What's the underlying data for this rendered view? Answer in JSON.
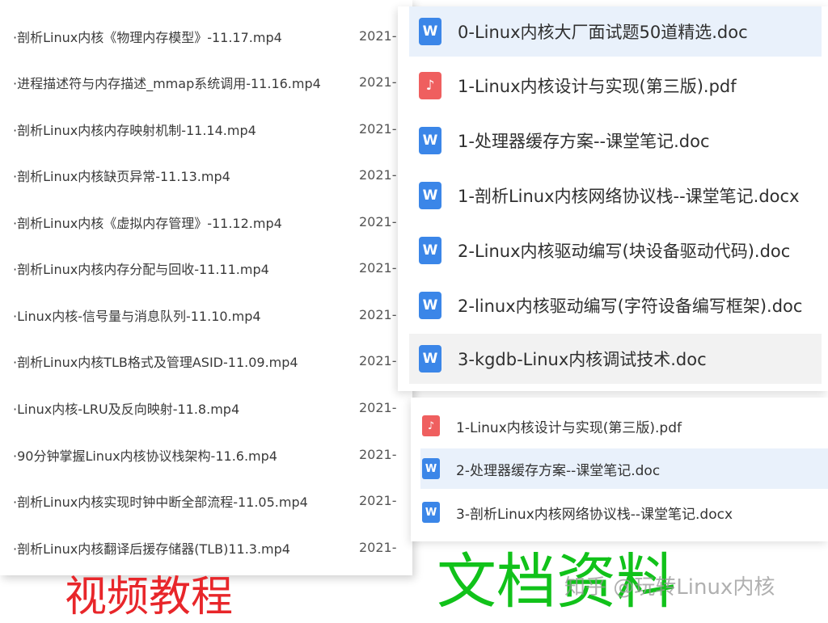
{
  "video_list": {
    "items": [
      {
        "name": "·剖析Linux内核《物理内存模型》-11.17.mp4",
        "date": "2021-"
      },
      {
        "name": "·进程描述符与内存描述_mmap系统调用-11.16.mp4",
        "date": "2021-"
      },
      {
        "name": "·剖析Linux内核内存映射机制-11.14.mp4",
        "date": "2021-"
      },
      {
        "name": "·剖析Linux内核缺页异常-11.13.mp4",
        "date": "2021-"
      },
      {
        "name": "·剖析Linux内核《虚拟内存管理》-11.12.mp4",
        "date": "2021-"
      },
      {
        "name": "·剖析Linux内核内存分配与回收-11.11.mp4",
        "date": "2021-"
      },
      {
        "name": "·Linux内核-信号量与消息队列-11.10.mp4",
        "date": "2021-"
      },
      {
        "name": "·剖析Linux内核TLB格式及管理ASID-11.09.mp4",
        "date": "2021-"
      },
      {
        "name": "·Linux内核-LRU及反向映射-11.8.mp4",
        "date": "2021-"
      },
      {
        "name": "·90分钟掌握Linux内核协议栈架构-11.6.mp4",
        "date": "2021-"
      },
      {
        "name": "·剖析Linux内核实现时钟中断全部流程-11.05.mp4",
        "date": "2021-"
      },
      {
        "name": "·剖析Linux内核翻译后援存储器(TLB)11.3.mp4",
        "date": "2021-"
      }
    ]
  },
  "doc_list_top": {
    "items": [
      {
        "icon": "word-doc-icon",
        "icon_glyph": "W",
        "name": "0-Linux内核大厂面试题50道精选.doc"
      },
      {
        "icon": "pdf-icon",
        "icon_glyph": "♪",
        "name": "1-Linux内核设计与实现(第三版).pdf"
      },
      {
        "icon": "word-doc-icon",
        "icon_glyph": "W",
        "name": "1-处理器缓存方案--课堂笔记.doc"
      },
      {
        "icon": "word-doc-icon",
        "icon_glyph": "W",
        "name": "1-剖析Linux内核网络协议栈--课堂笔记.docx"
      },
      {
        "icon": "word-doc-icon",
        "icon_glyph": "W",
        "name": "2-Linux内核驱动编写(块设备驱动代码).doc"
      },
      {
        "icon": "word-doc-icon",
        "icon_glyph": "W",
        "name": "2-linux内核驱动编写(字符设备编写框架).doc"
      },
      {
        "icon": "word-doc-icon",
        "icon_glyph": "W",
        "name": "3-kgdb-Linux内核调试技术.doc"
      }
    ]
  },
  "doc_list_bottom": {
    "items": [
      {
        "icon": "pdf-icon",
        "icon_glyph": "♪",
        "name": "1-Linux内核设计与实现(第三版).pdf"
      },
      {
        "icon": "word-doc-icon",
        "icon_glyph": "W",
        "name": "2-处理器缓存方案--课堂笔记.doc"
      },
      {
        "icon": "word-doc-icon",
        "icon_glyph": "W",
        "name": "3-剖析Linux内核网络协议栈--课堂笔记.docx"
      }
    ]
  },
  "captions": {
    "video": "视频教程",
    "docs": "文档资料"
  },
  "watermark": "知乎 @玩转Linux内核",
  "colors": {
    "video_caption": "#e8262a",
    "docs_caption": "#11c21a",
    "word_icon": "#3b86e8",
    "pdf_icon": "#ef5f5f",
    "selected_row": "#e9f1fb"
  }
}
